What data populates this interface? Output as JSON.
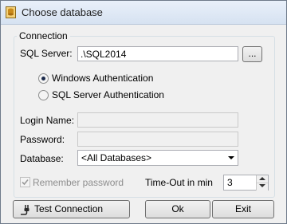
{
  "window": {
    "title": "Choose database",
    "icon": "database-app-icon"
  },
  "connection": {
    "group_label": "Connection",
    "server_label": "SQL Server:",
    "server_value": ".\\SQL2014",
    "browse_label": "...",
    "auth_windows": "Windows Authentication",
    "auth_sql": "SQL Server Authentication",
    "selected_auth": "windows",
    "login_label": "Login Name:",
    "login_value": "",
    "password_label": "Password:",
    "password_value": "",
    "database_label": "Database:",
    "database_value": "<All Databases>"
  },
  "options": {
    "remember_label": "Remember password",
    "remember_checked": true,
    "timeout_label": "Time-Out in min",
    "timeout_value": "3"
  },
  "buttons": {
    "test": "Test Connection",
    "ok": "Ok",
    "exit": "Exit"
  },
  "colors": {
    "accent": "#1b2a4a",
    "disabled_text": "#8e8e8e"
  }
}
